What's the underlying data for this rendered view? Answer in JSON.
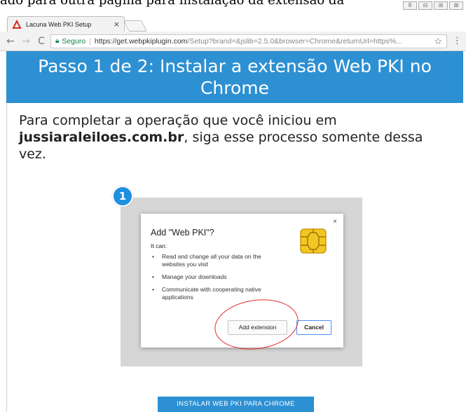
{
  "caption": "ado para outra página para instalação da extensão da",
  "window_controls": [
    "8",
    "⊟",
    "⊞",
    "⊠"
  ],
  "browser": {
    "tab_title": "Lacuna Web PKI Setup",
    "tab_close": "×",
    "secure_label": "Seguro",
    "url_main": "https://get.webpkiplugin.com",
    "url_rest": "/Setup?brand=&jslib=2.5.0&browser=Chrome&returnUrl=https%...",
    "nav": {
      "back": "←",
      "forward": "→",
      "reload": "C"
    },
    "star": "☆",
    "menu": "⋮"
  },
  "hero": {
    "line1": "Passo 1 de 2: Instalar a extensão Web PKI no",
    "line2": "Chrome"
  },
  "intro": {
    "pre": "Para completar a operação que você iniciou em",
    "domain": "jussiaraleiloes.com.br",
    "post": ", siga esse processo somente dessa vez."
  },
  "step_badge": "1",
  "dialog": {
    "title": "Add \"Web PKI\"?",
    "subtitle": "It can:",
    "items": [
      "Read and change all your data on the websites you visit",
      "Manage your downloads",
      "Communicate with cooperating native applications"
    ],
    "close": "×",
    "add_button": "Add extension",
    "cancel_button": "Cancel"
  },
  "install_button": "INSTALAR WEB PKI PARA CHROME",
  "colors": {
    "hero_bg": "#2d90d2",
    "highlight": "#e02b2b",
    "secure": "#0b8043",
    "chip_gold": "#f3c623"
  }
}
